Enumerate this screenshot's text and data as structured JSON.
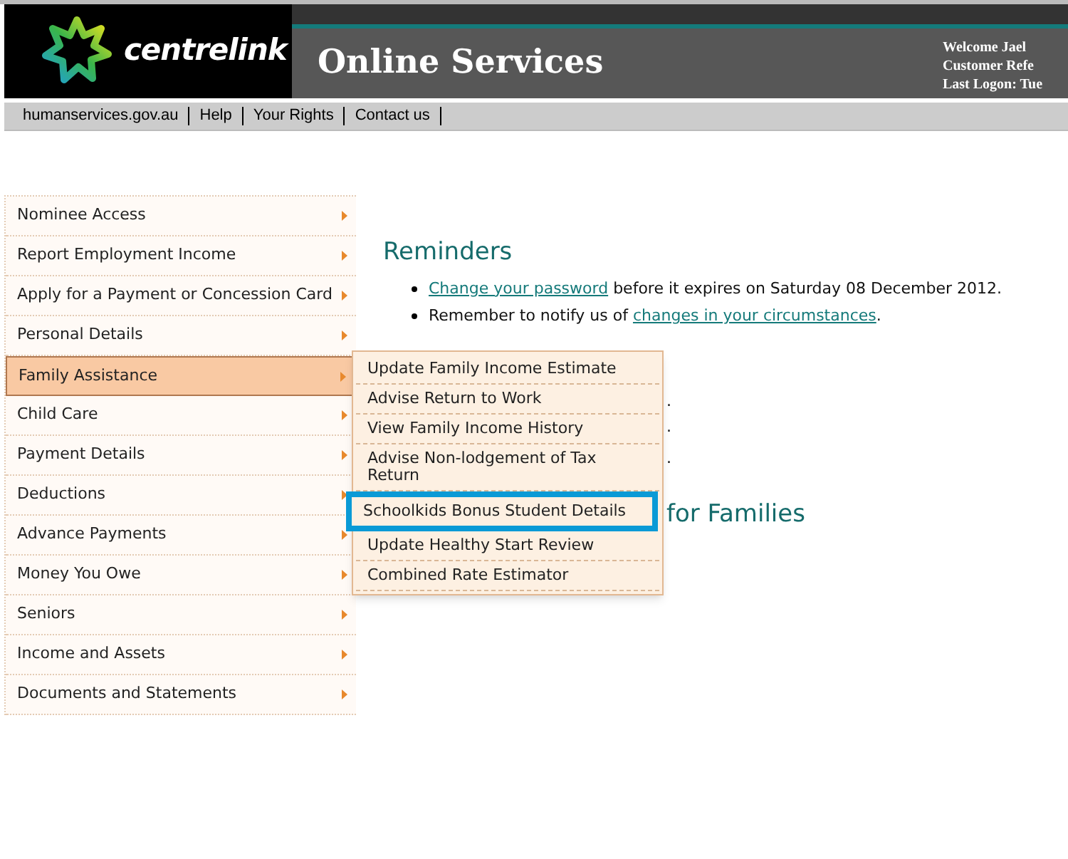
{
  "header": {
    "logo_text": "centrelink",
    "title": "Online Services",
    "user_lines": [
      "Welcome Jael",
      "Customer Refe",
      "Last Logon: Tue"
    ]
  },
  "nav_links": [
    "humanservices.gov.au",
    "Help",
    "Your Rights",
    "Contact us"
  ],
  "sidebar": {
    "items": [
      {
        "label": "Nominee Access",
        "selected": false
      },
      {
        "label": "Report Employment Income",
        "selected": false
      },
      {
        "label": "Apply for a Payment or Concession Card",
        "selected": false
      },
      {
        "label": "Personal Details",
        "selected": false
      },
      {
        "label": "Family Assistance",
        "selected": true
      },
      {
        "label": "Child Care",
        "selected": false
      },
      {
        "label": "Payment Details",
        "selected": false
      },
      {
        "label": "Deductions",
        "selected": false
      },
      {
        "label": "Advance Payments",
        "selected": false
      },
      {
        "label": "Money You Owe",
        "selected": false
      },
      {
        "label": "Seniors",
        "selected": false
      },
      {
        "label": "Income and Assets",
        "selected": false
      },
      {
        "label": "Documents and Statements",
        "selected": false
      }
    ]
  },
  "submenu": {
    "items": [
      {
        "label": "Update Family Income Estimate",
        "selected": false
      },
      {
        "label": "Advise Return to Work",
        "selected": false
      },
      {
        "label": "View Family Income History",
        "selected": false
      },
      {
        "label": "Advise Non-lodgement of Tax Return",
        "selected": false
      },
      {
        "label": "Schoolkids Bonus Student Details",
        "selected": true
      },
      {
        "label": "Update Healthy Start Review",
        "selected": false
      },
      {
        "label": "Combined Rate Estimator",
        "selected": false
      }
    ]
  },
  "reminders": {
    "heading": "Reminders",
    "items": [
      {
        "link": "Change your password",
        "after": " before it expires on Saturday 08 December 2012."
      },
      {
        "before": "Remember to notify us of ",
        "link": "changes in your circumstances",
        "after": "."
      }
    ]
  },
  "partly_hidden": {
    "line_ends": [
      ".",
      ".",
      "."
    ],
    "heading": "for Families"
  }
}
